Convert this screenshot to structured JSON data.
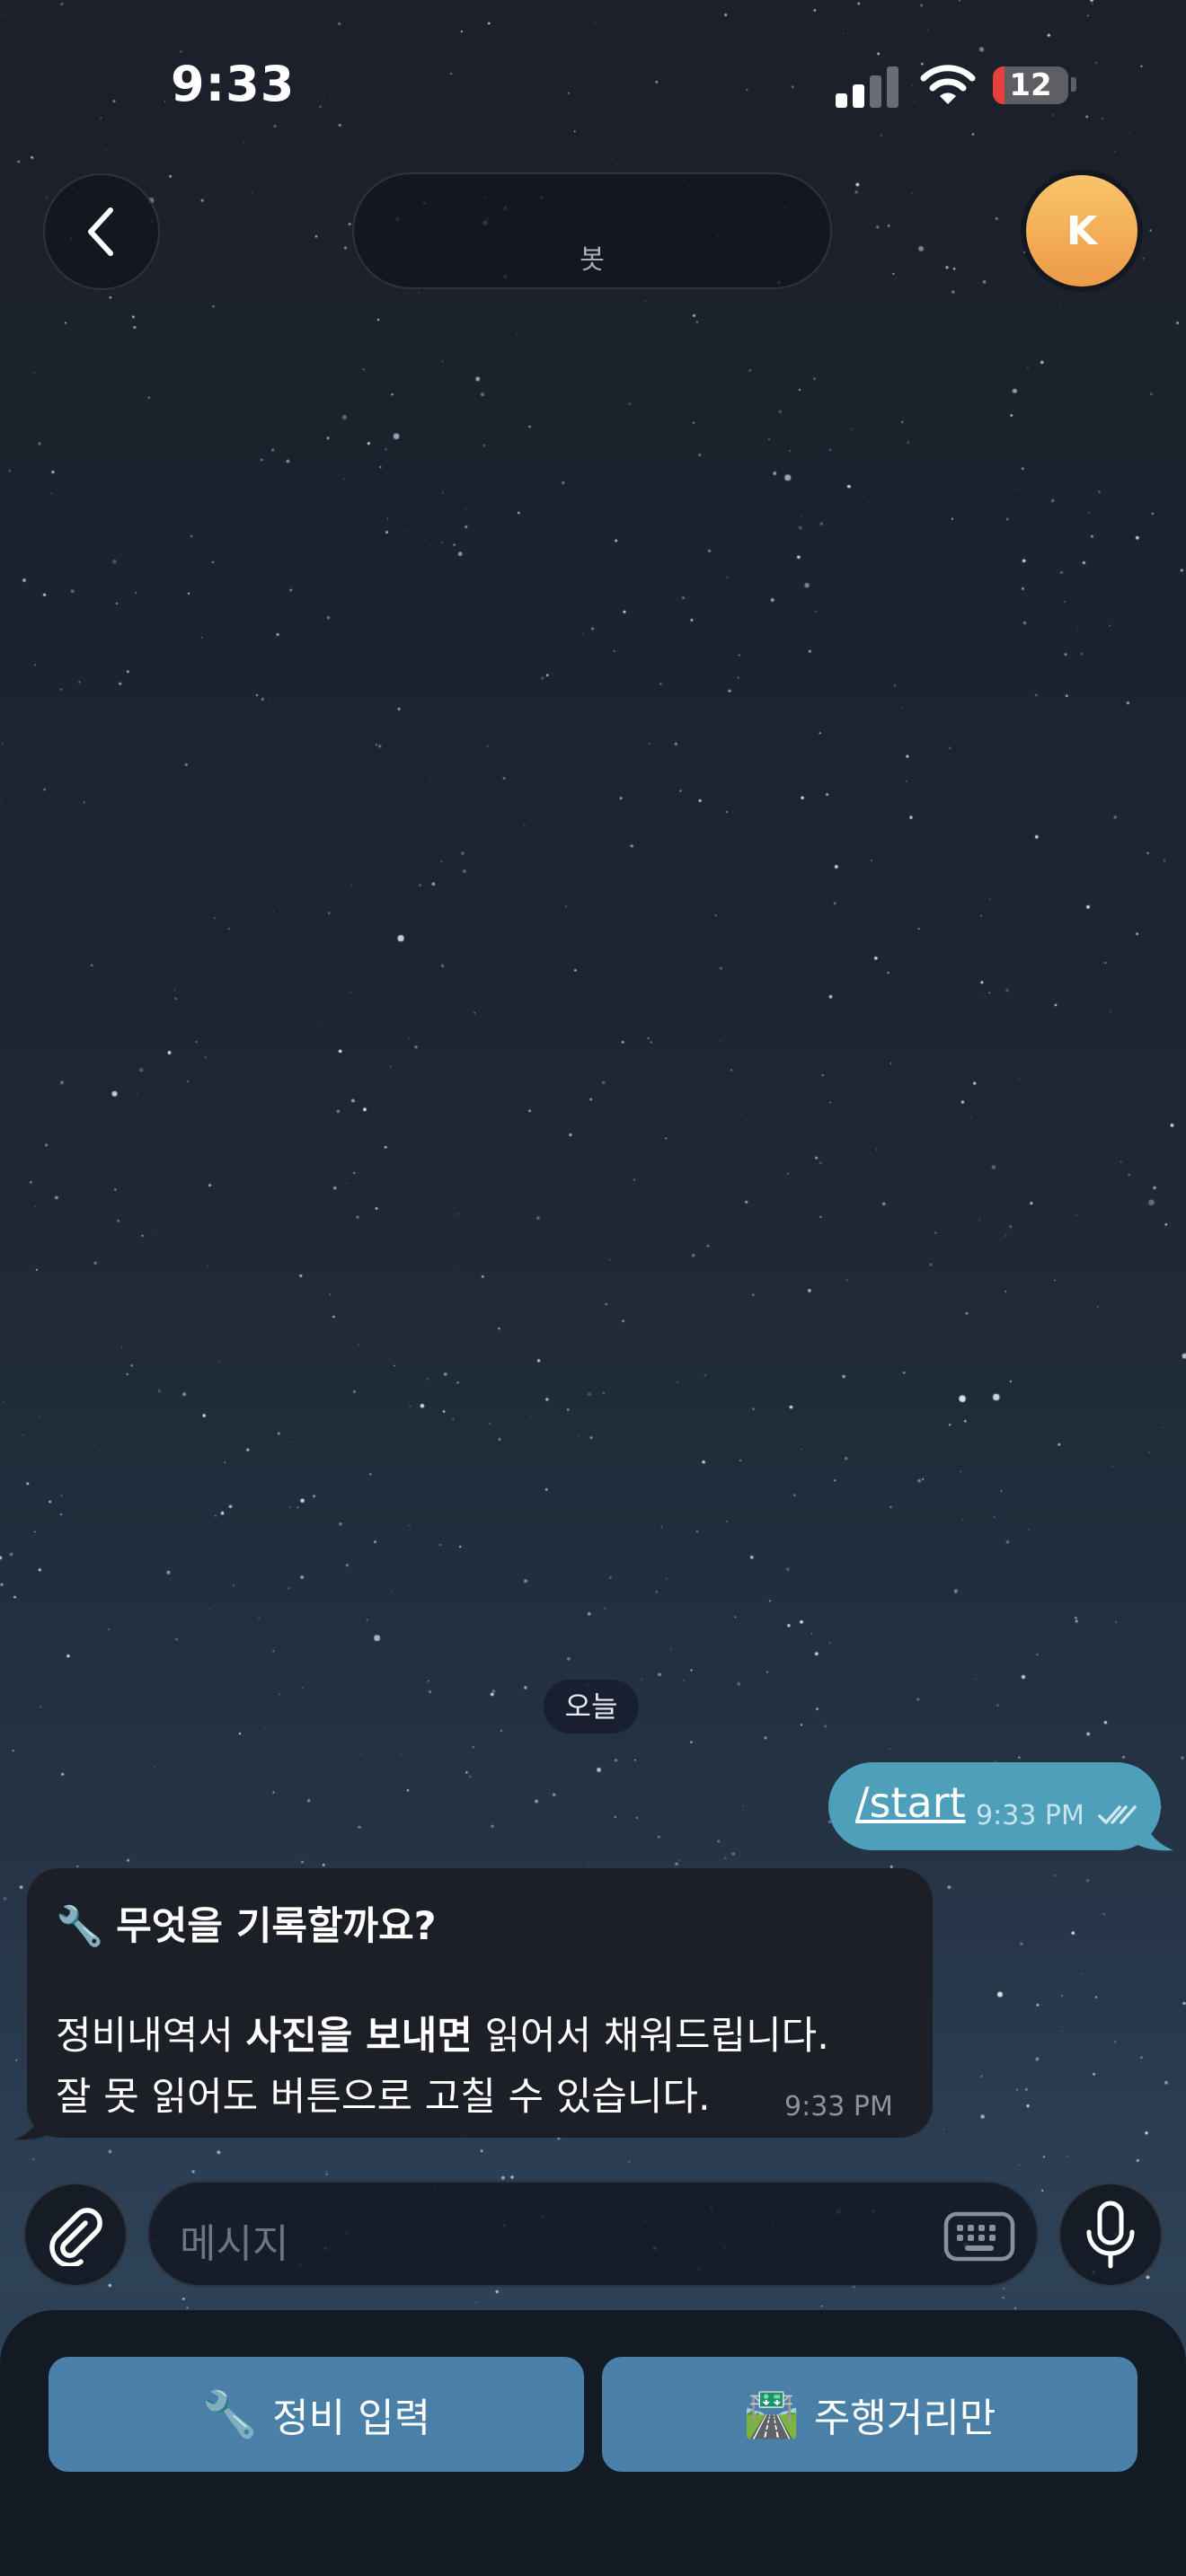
{
  "status_bar": {
    "time": "9:33",
    "battery": "12",
    "battery_color": "#e8403d"
  },
  "header": {
    "back_icon": "chevron-left-icon",
    "title": "봇",
    "avatar_initial": "K",
    "avatar_color": "#f2b05a"
  },
  "chat": {
    "date_label": "오늘",
    "outgoing": {
      "text": "/start",
      "time": "9:33 PM",
      "status_icon": "double-check-icon",
      "bubble_color": "#4ea0ba"
    },
    "incoming": {
      "title_emoji": "🔧",
      "title": "무엇을 기록할까요?",
      "line2_prefix": "정비내역서 ",
      "line2_bold": "사진을 보내면",
      "line2_suffix": " 읽어서 채워드립니다.",
      "line3": "잘 못 읽어도 버튼으로 고칠 수 있습니다.",
      "time": "9:33 PM"
    }
  },
  "composer": {
    "placeholder": "메시지",
    "attach_icon": "paperclip-icon",
    "keyboard_icon": "keyboard-icon",
    "mic_icon": "microphone-icon"
  },
  "reply_keyboard": {
    "buttons": [
      {
        "emoji": "🔧",
        "label": "정비 입력"
      },
      {
        "emoji": "🛣️",
        "label": "주행거리만"
      }
    ],
    "button_color": "#4a7fa8"
  }
}
